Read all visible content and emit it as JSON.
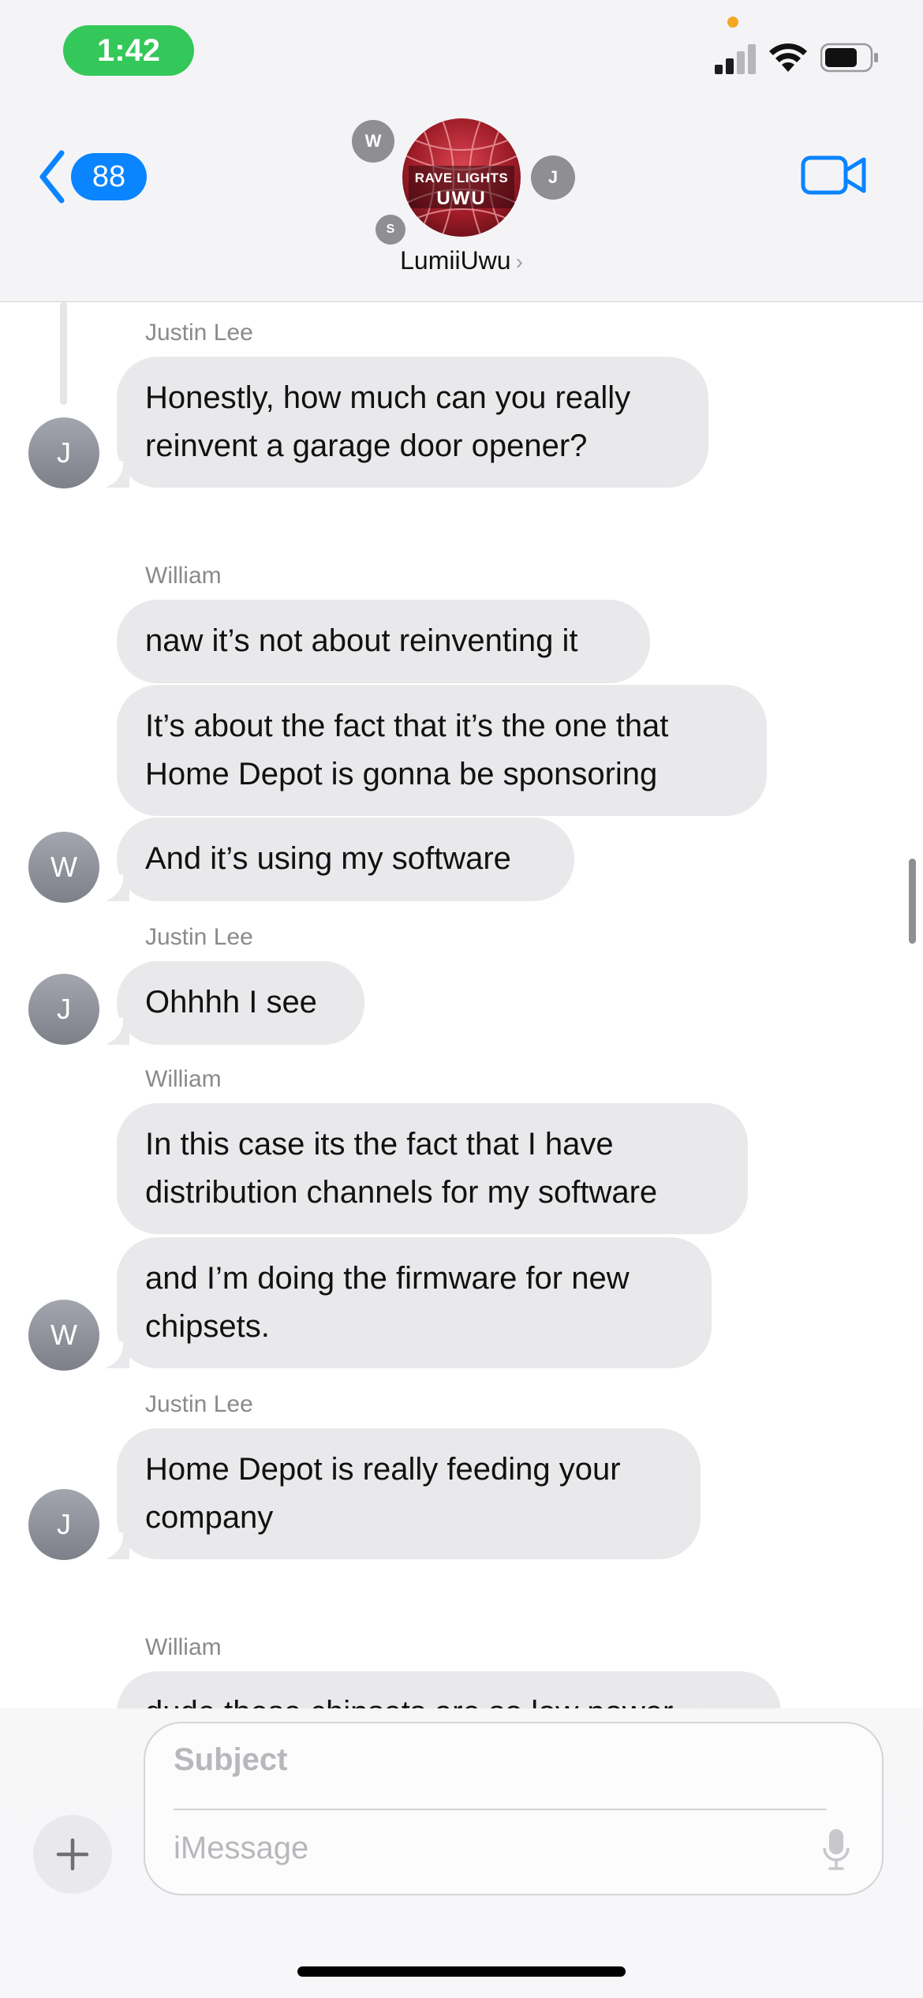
{
  "status_bar": {
    "time": "1:42"
  },
  "header": {
    "unread_count": "88",
    "group_name": "LumiiUwu",
    "group_logo_top": "RAVE LIGHTS",
    "group_logo_bottom": "UWU",
    "member_initials": [
      "W",
      "J",
      "S"
    ]
  },
  "messages": [
    {
      "sender": "Justin Lee",
      "initial": "J",
      "lines": [
        "Honestly, how much can you really",
        "reinvent a garage door opener?"
      ]
    },
    {
      "sender": "William",
      "initial": "W",
      "lines": [
        "naw it’s not about reinventing it"
      ]
    },
    {
      "sender": "",
      "initial": "W",
      "lines": [
        "It’s about the fact that it’s the one that",
        "Home Depot is gonna be sponsoring"
      ]
    },
    {
      "sender": "",
      "initial": "W",
      "lines": [
        "And it’s using my software"
      ]
    },
    {
      "sender": "Justin Lee",
      "initial": "J",
      "lines": [
        "Ohhhh I see"
      ]
    },
    {
      "sender": "William",
      "initial": "W",
      "lines": [
        "In this case its the fact that I have",
        "distribution channels for my software"
      ]
    },
    {
      "sender": "",
      "initial": "W",
      "lines": [
        "and I’m doing the firmware for new",
        "chipsets."
      ]
    },
    {
      "sender": "Justin Lee",
      "initial": "J",
      "lines": [
        "Home Depot is really feeding your",
        "company"
      ]
    },
    {
      "sender": "William",
      "initial": "W",
      "lines": [
        "dude these chipsets are so low power"
      ]
    }
  ],
  "compose": {
    "subject_placeholder": "Subject",
    "message_placeholder": "iMessage"
  },
  "colors": {
    "accent": "#0a84ff",
    "time_pill": "#34c759",
    "bubble_received": "#e9e9eb",
    "avatar_gray": "#8e8e93"
  }
}
